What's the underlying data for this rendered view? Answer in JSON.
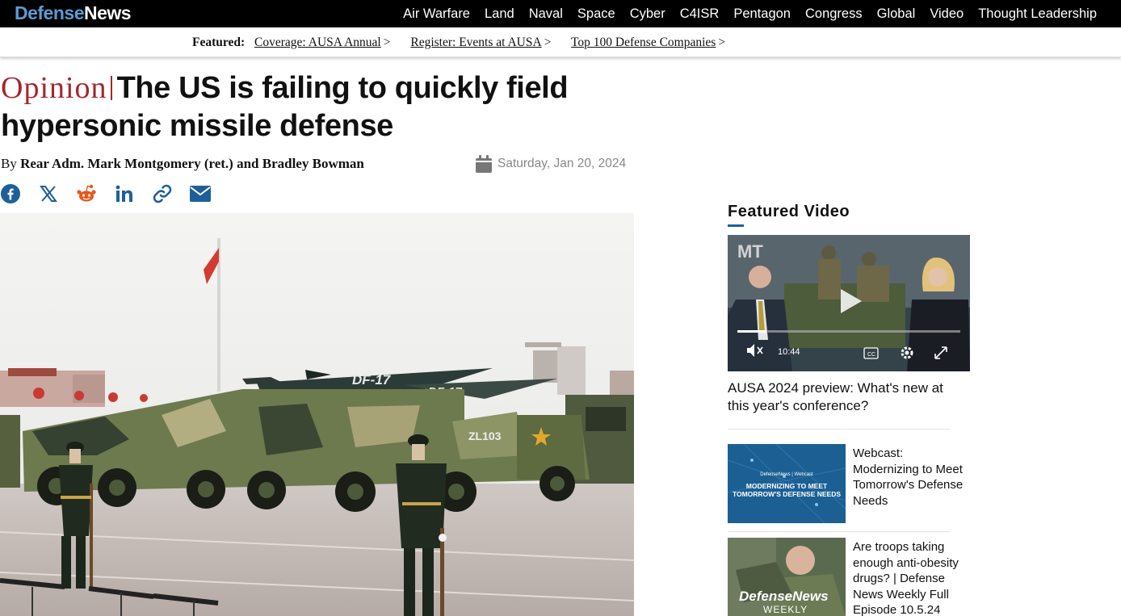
{
  "brand": {
    "part1": "Defense",
    "part2": "News",
    "color_accent": "#5b9bd5"
  },
  "nav": {
    "items": [
      {
        "label": "Air Warfare"
      },
      {
        "label": "Land"
      },
      {
        "label": "Naval"
      },
      {
        "label": "Space"
      },
      {
        "label": "Cyber"
      },
      {
        "label": "C4ISR"
      },
      {
        "label": "Pentagon"
      },
      {
        "label": "Congress"
      },
      {
        "label": "Global"
      },
      {
        "label": "Video"
      },
      {
        "label": "Thought Leadership"
      }
    ]
  },
  "featured": {
    "label": "Featured:",
    "links": [
      {
        "label": "Coverage: AUSA Annual"
      },
      {
        "label": "Register: Events at AUSA"
      },
      {
        "label": "Top 100 Defense Companies"
      }
    ],
    "chevron": ">"
  },
  "article": {
    "kicker": "Opinion",
    "title": "The US is failing to quickly field hypersonic missile defense",
    "by": "By",
    "authors": "Rear Adm. Mark Montgomery (ret.) and Bradley Bowman",
    "date": "Saturday, Jan 20, 2024",
    "kicker_color": "#a4262c",
    "share_icons": [
      "facebook-icon",
      "x-icon",
      "reddit-icon",
      "linkedin-icon",
      "link-icon",
      "email-icon"
    ],
    "hero_text": {
      "label1": "DF-17",
      "label2": "DF-17",
      "plate": "ZL103"
    }
  },
  "sidebar": {
    "title": "Featured Video",
    "video": {
      "badge": "MT",
      "time": "10:44",
      "cc": "CC",
      "caption": "AUSA 2024 preview: What's new at this year's conference?"
    },
    "items": [
      {
        "thumb_small": "DefenseNews | Webcast",
        "thumb_line1": "MODERNIZING TO MEET",
        "thumb_line2": "TOMORROW'S DEFENSE NEEDS",
        "text": "Webcast: Modernizing to Meet Tomorrow's Defense Needs"
      },
      {
        "thumb_line1": "DefenseNews",
        "thumb_line2": "WEEKLY",
        "text": "Are troops taking enough anti-obesity drugs? | Defense News Weekly Full Episode 10.5.24"
      }
    ]
  }
}
